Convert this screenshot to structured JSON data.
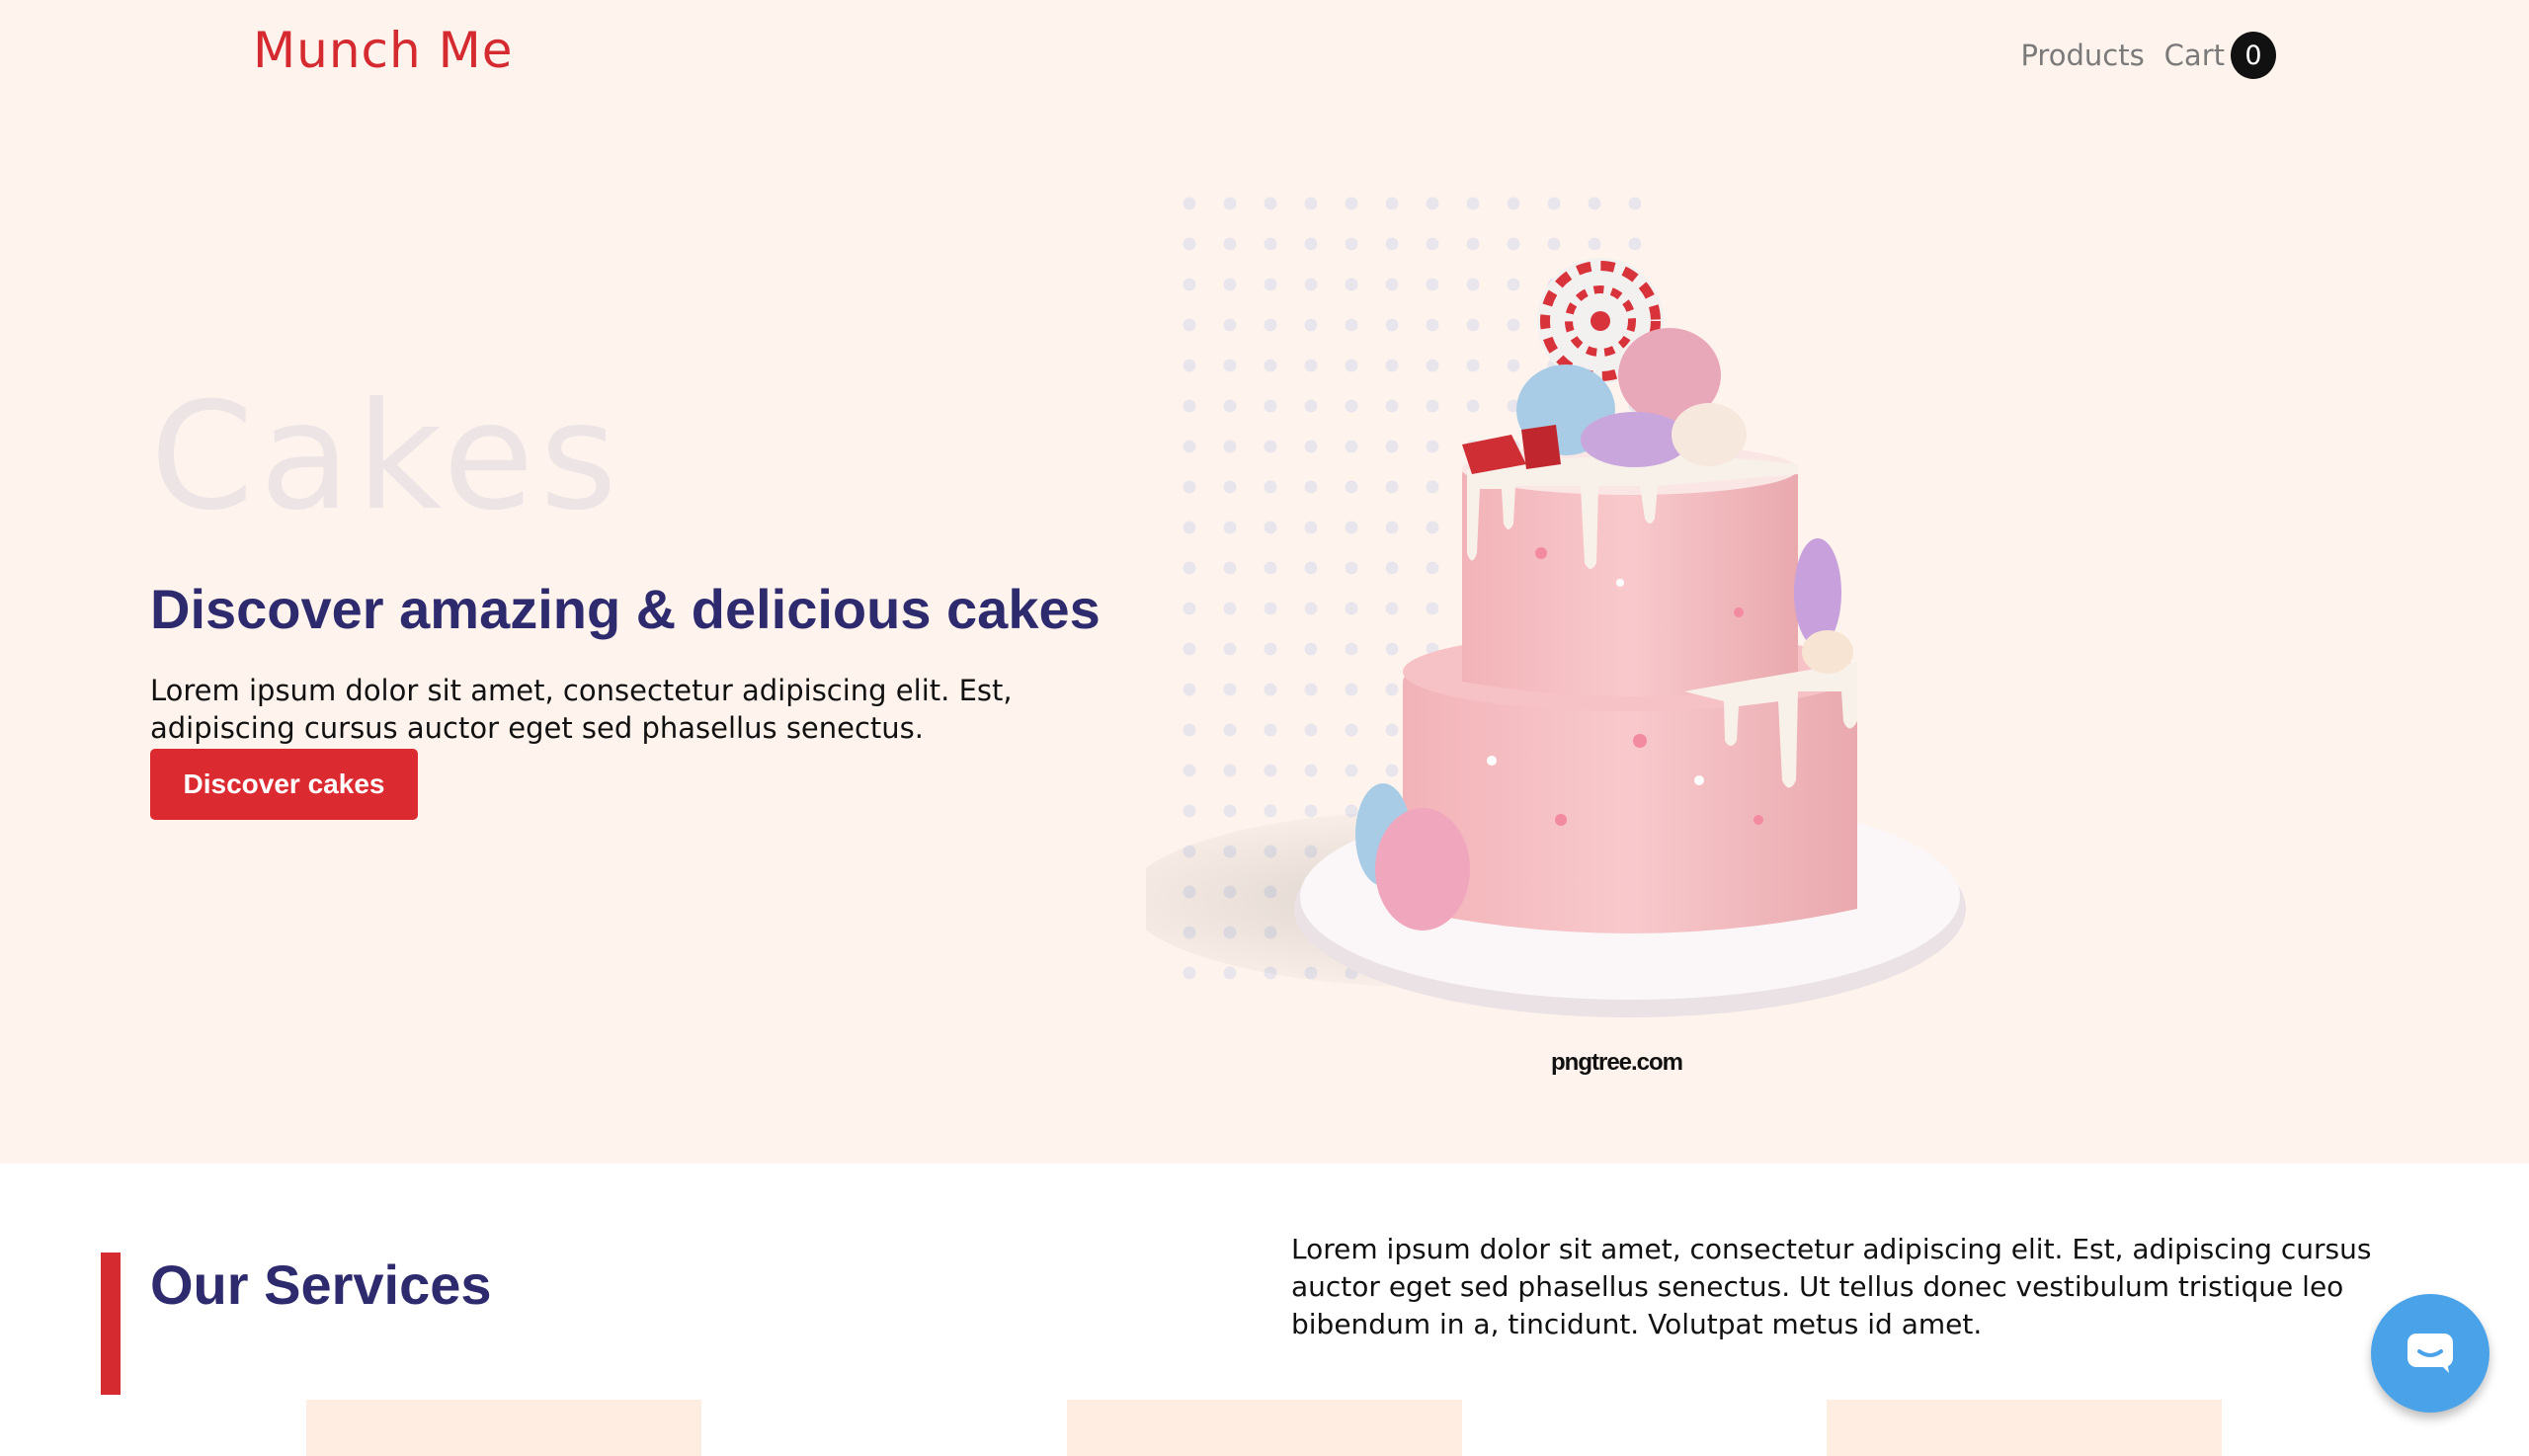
{
  "header": {
    "brand": "Munch Me",
    "nav": {
      "products": "Products",
      "cart": "Cart",
      "cart_count": "0"
    }
  },
  "hero": {
    "bg_word": "Cakes",
    "heading": "Discover amazing & delicious cakes",
    "text": "Lorem ipsum dolor sit amet, consectetur adipiscing elit. Est, adipiscing cursus auctor eget sed phasellus senectus.",
    "button": "Discover cakes",
    "image_watermark": "pngtree.com"
  },
  "services": {
    "title": "Our Services",
    "text": "Lorem ipsum dolor sit amet, consectetur adipiscing elit. Est, adipiscing cursus auctor eget sed phasellus senectus. Ut tellus donec vestibulum tristique leo bibendum in a, tincidunt. Volutpat metus id amet."
  },
  "colors": {
    "brand": "#d42a30",
    "heading": "#2d2a6e",
    "hero_bg": "#fff4ed",
    "chat": "#4aa3e8"
  },
  "icons": {
    "chat": "chat-icon"
  }
}
